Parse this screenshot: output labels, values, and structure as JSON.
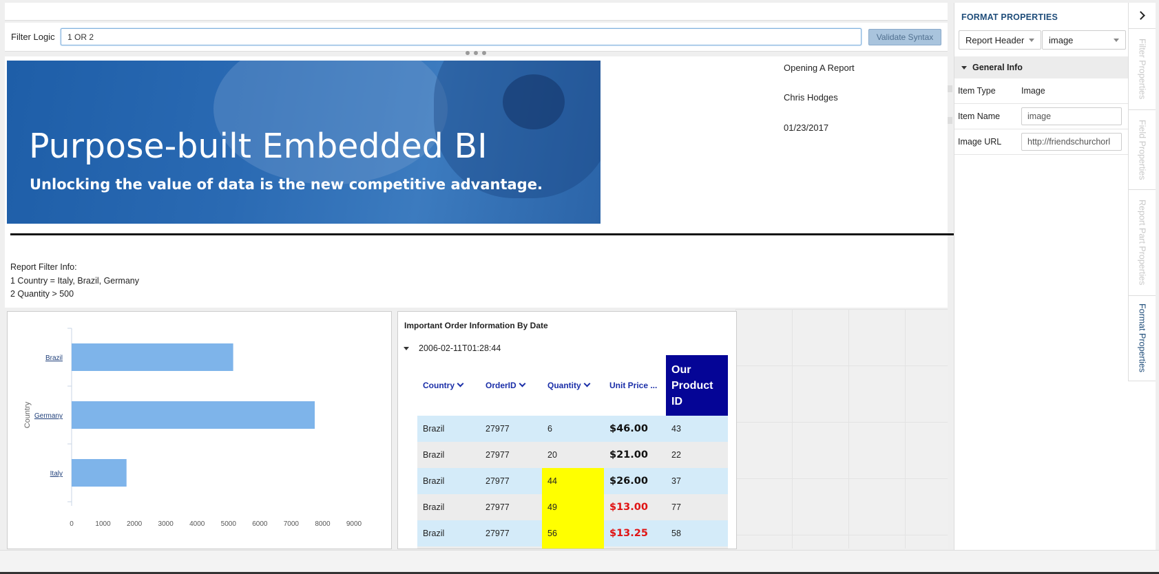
{
  "filter": {
    "label": "Filter Logic",
    "value": "1 OR 2",
    "validate_label": "Validate Syntax"
  },
  "report": {
    "banner_title": "Purpose-built Embedded BI",
    "banner_subtitle": "Unlocking the value of data is the new competitive advantage.",
    "meta_title": "Opening A Report",
    "meta_author": "Chris Hodges",
    "meta_date": "01/23/2017",
    "filter_info": {
      "heading": "Report Filter Info:",
      "line1": "1 Country = Italy, Brazil, Germany",
      "line2": "2 Quantity > 500"
    }
  },
  "chart_data": {
    "type": "bar",
    "orientation": "horizontal",
    "categories": [
      "Brazil",
      "Germany",
      "Italy"
    ],
    "values": [
      5150,
      7750,
      1750
    ],
    "ylabel": "Country",
    "xlim": [
      0,
      9000
    ],
    "xticks": [
      "0",
      "1000",
      "2000",
      "3000",
      "4000",
      "5000",
      "6000",
      "7000",
      "8000",
      "9000"
    ],
    "bar_color": "#7eb4ea"
  },
  "table": {
    "title": "Important Order Information By Date",
    "group": "2006-02-11T01:28:44",
    "headers": [
      "Country",
      "OrderID",
      "Quantity",
      "Unit Price ...",
      "Our Product ID"
    ],
    "product_id_lines": [
      "Our",
      "Product",
      "ID"
    ],
    "rows": [
      {
        "country": "Brazil",
        "order": "27977",
        "qty": "6",
        "price": "$46.00",
        "pid": "43"
      },
      {
        "country": "Brazil",
        "order": "27977",
        "qty": "20",
        "price": "$21.00",
        "pid": "22"
      },
      {
        "country": "Brazil",
        "order": "27977",
        "qty": "44",
        "price": "$26.00",
        "pid": "37"
      },
      {
        "country": "Brazil",
        "order": "27977",
        "qty": "49",
        "price": "$13.00",
        "pid": "77"
      },
      {
        "country": "Brazil",
        "order": "27977",
        "qty": "56",
        "price": "$13.25",
        "pid": "58"
      }
    ]
  },
  "format_panel": {
    "title": "FORMAT PROPERTIES",
    "section_select": "Report Header",
    "item_select": "image",
    "section_heading": "General Info",
    "item_type_label": "Item Type",
    "item_type_value": "Image",
    "item_name_label": "Item Name",
    "item_name_value": "image",
    "image_url_label": "Image URL",
    "image_url_value": "http://friendschurchorl"
  },
  "side_tabs": {
    "filter": "Filter Properties",
    "field": "Field Properties",
    "report_part": "Report Part Properties",
    "format": "Format Properties"
  },
  "colors": {
    "accent": "#1f4d7a",
    "header_cell": "#050596",
    "highlight": "#ffff00",
    "price_red": "#e01414"
  }
}
